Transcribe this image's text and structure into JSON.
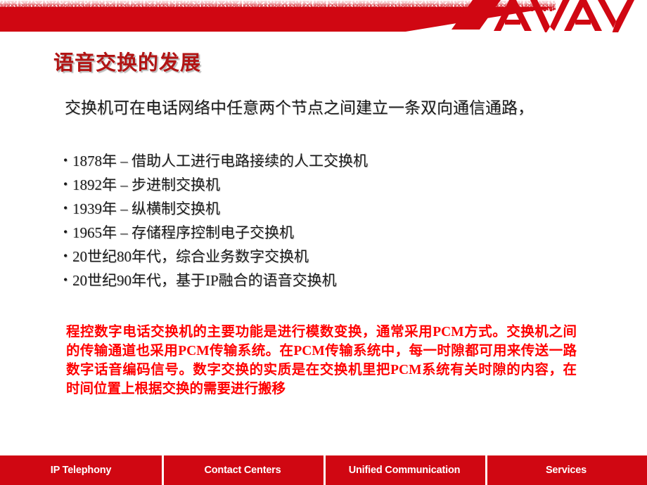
{
  "branding": {
    "logo_text": "AVAYA",
    "brand_red": "#D00712",
    "title_red": "#B21414",
    "highlight_red": "#FF0000"
  },
  "slide": {
    "title": "语音交换的发展",
    "intro": "交换机可在电话网络中任意两个节点之间建立一条双向通信通路，",
    "bullets": [
      {
        "marker": "•",
        "text": "1878年 – 借助人工进行电路接续的人工交换机"
      },
      {
        "marker": "•",
        "text": "1892年 – 步进制交换机"
      },
      {
        "marker": "•",
        "text": "1939年 – 纵横制交换机"
      },
      {
        "marker": "•",
        "text": "1965年 – 存储程序控制电子交换机"
      },
      {
        "marker": "•",
        "text": "20世纪80年代，综合业务数字交换机"
      },
      {
        "marker": "•",
        "text": "20世纪90年代，基于IP融合的语音交换机"
      }
    ],
    "note": "程控数字电话交换机的主要功能是进行模数变换，通常采用PCM方式。交换机之间的传输通道也采用PCM传输系统。在PCM传输系统中，每一时隙都可用来传送一路数字话音编码信号。数字交换的实质是在交换机里把PCM系统有关时隙的内容，在时间位置上根据交换的需要进行搬移"
  },
  "footer": {
    "items": [
      {
        "label": "IP Telephony"
      },
      {
        "label": "Contact Centers"
      },
      {
        "label": "Unified Communication"
      },
      {
        "label": "Services"
      }
    ]
  }
}
